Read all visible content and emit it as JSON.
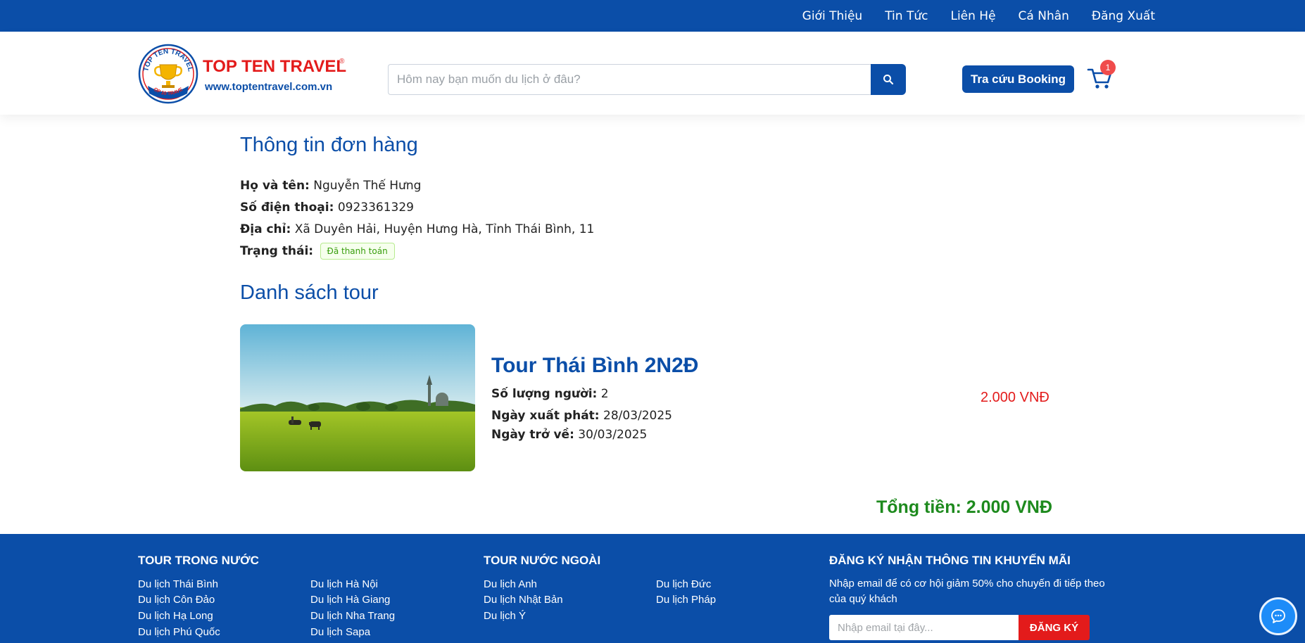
{
  "topnav": {
    "items": [
      "Giới Thiệu",
      "Tin Tức",
      "Liên Hệ",
      "Cá Nhân",
      "Đăng Xuất"
    ]
  },
  "header": {
    "logo": {
      "brand": "TOP TEN TRAVEL",
      "url": "www.toptentravel.com.vn",
      "ring_text": "TOP TEN TRAVEL",
      "ribbon_text": "TOP 10 TRAVEL"
    },
    "search_placeholder": "Hôm nay bạn muốn du lịch ở đâu?",
    "booking_label": "Tra cứu Booking",
    "cart_count": "1"
  },
  "order": {
    "heading": "Thông tin đơn hàng",
    "name_label": "Họ và tên:",
    "name_value": "Nguyễn Thế Hưng",
    "phone_label": "Số điện thoại:",
    "phone_value": "0923361329",
    "address_label": "Địa chỉ:",
    "address_value": "Xã Duyên Hải, Huyện Hưng Hà, Tỉnh Thái Bình, 11",
    "status_label": "Trạng thái:",
    "status_value": "Đã thanh toán"
  },
  "tours": {
    "heading": "Danh sách tour",
    "items": [
      {
        "name": "Tour Thái Bình 2N2Đ",
        "people_label": "Số lượng người:",
        "people_value": "2",
        "start_label": "Ngày xuất phát:",
        "start_value": "28/03/2025",
        "end_label": "Ngày trở về:",
        "end_value": "30/03/2025",
        "price": "2.000 VNĐ"
      }
    ],
    "total": "Tổng tiền: 2.000 VNĐ"
  },
  "footer": {
    "domestic": {
      "heading": "TOUR TRONG NƯỚC",
      "col1": [
        "Du lịch Thái Bình",
        "Du lịch Côn Đảo",
        "Du lịch Hạ Long",
        "Du lịch Phú Quốc"
      ],
      "col2": [
        "Du lịch Hà Nội",
        "Du lịch Hà Giang",
        "Du lịch Nha Trang",
        "Du lịch Sapa"
      ]
    },
    "international": {
      "heading": "TOUR NƯỚC NGOÀI",
      "col1": [
        "Du lịch Anh",
        "Du lịch Nhật Bản",
        "Du lịch Ý"
      ],
      "col2": [
        "Du lịch Đức",
        "Du lịch Pháp"
      ]
    },
    "newsletter": {
      "heading": "ĐĂNG KÝ NHẬN THÔNG TIN KHUYẾN MÃI",
      "description": "Nhập email để có cơ hội giảm 50% cho chuyến đi tiếp theo của quý khách",
      "email_placeholder": "Nhập email tại đây...",
      "button_label": "ĐĂNG KÝ"
    }
  },
  "colors": {
    "primary": "#0b4ea8",
    "price": "#e31b1b",
    "total": "#1d8a1d",
    "status_green": "#389e0d",
    "chat": "#1d8cf8"
  },
  "icons": [
    "search-icon",
    "cart-icon",
    "chat-icon"
  ]
}
